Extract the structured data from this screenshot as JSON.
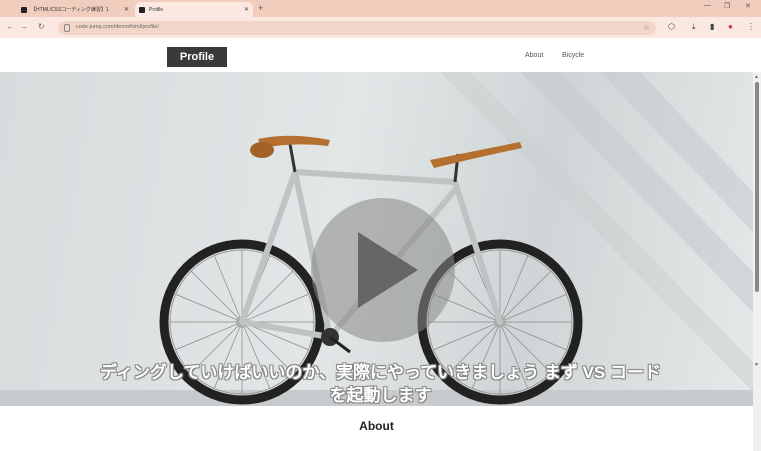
{
  "browser": {
    "tabs": [
      {
        "title": "【HTML/CSSコーディング練習】1"
      },
      {
        "title": "Profile"
      }
    ],
    "url": "code-jump.com/demo/html/profile/"
  },
  "site": {
    "logo": "Profile",
    "nav": [
      "About",
      "Bicycle"
    ],
    "section_heading": "About"
  },
  "caption": {
    "line1": "ディングしていけばいいのか、実際にやっていきましょう まず VS コード",
    "line2": "を起動します"
  },
  "video": {
    "state": "paused"
  }
}
